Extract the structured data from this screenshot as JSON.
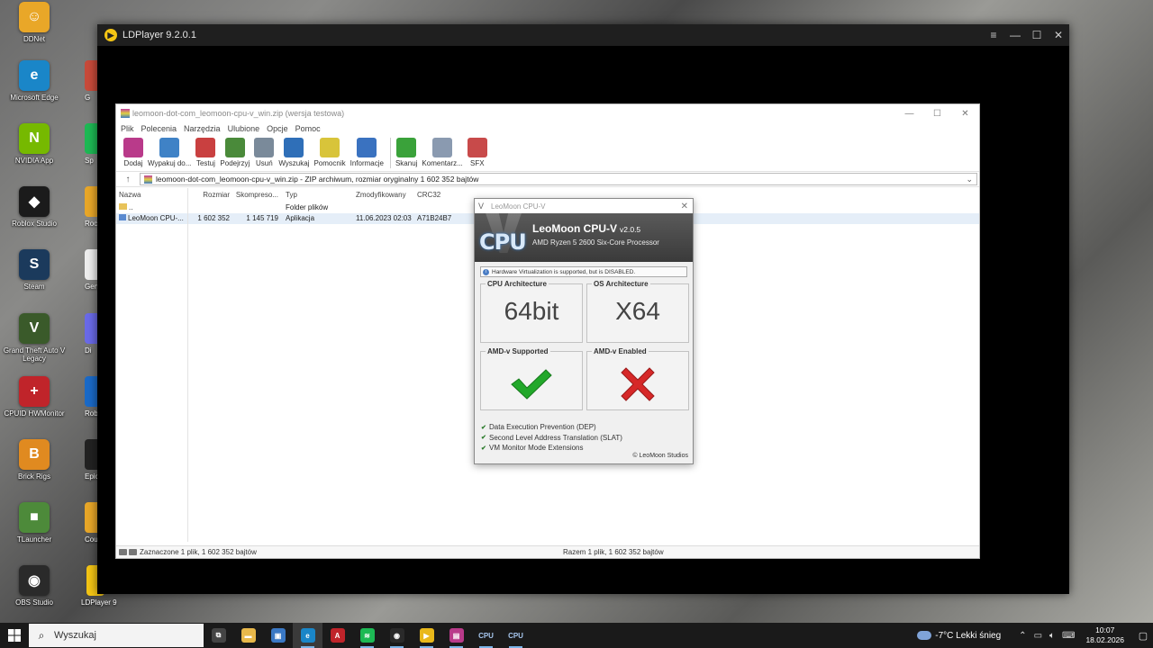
{
  "desktop": {
    "icons": [
      {
        "label": "DDNet",
        "color": "#e9a728",
        "glyph": "☺"
      },
      {
        "label": "Microsoft Edge",
        "color": "#1a86c8",
        "glyph": "e"
      },
      {
        "label": "NVIDIA App",
        "color": "#76b900",
        "glyph": "N"
      },
      {
        "label": "Roblox Studio",
        "color": "#1b1b1b",
        "glyph": "◆"
      },
      {
        "label": "Steam",
        "color": "#1b3a5c",
        "glyph": "S"
      },
      {
        "label": "Grand Theft Auto V Legacy",
        "color": "#3a5a2a",
        "glyph": "V"
      },
      {
        "label": "CPUID HWMonitor",
        "color": "#c0242a",
        "glyph": "+"
      },
      {
        "label": "Brick Rigs",
        "color": "#e08a20",
        "glyph": "B"
      },
      {
        "label": "TLauncher",
        "color": "#4d8a3a",
        "glyph": "■"
      },
      {
        "label": "OBS Studio",
        "color": "#2a2a2a",
        "glyph": "◉"
      }
    ],
    "partial_labels": [
      "G",
      "Sp",
      "Rocks Lau",
      "Gensh",
      "Di",
      "Robl",
      "Epic Lau",
      "Count",
      "LDPlayer 9"
    ]
  },
  "ldplayer": {
    "title": "LDPlayer 9.2.0.1",
    "controls": [
      "≡",
      "—",
      "☐",
      "✕"
    ]
  },
  "winrar": {
    "title": "leomoon-dot-com_leomoon-cpu-v_win.zip (wersja testowa)",
    "menu": [
      "Plik",
      "Polecenia",
      "Narzędzia",
      "Ulubione",
      "Opcje",
      "Pomoc"
    ],
    "toolbar": [
      {
        "label": "Dodaj",
        "color": "#b93a8a"
      },
      {
        "label": "Wypakuj do...",
        "color": "#3f82c6"
      },
      {
        "label": "Testuj",
        "color": "#c94040"
      },
      {
        "label": "Podejrzyj",
        "color": "#4a8a3a"
      },
      {
        "label": "Usuń",
        "color": "#7a8a9a"
      },
      {
        "label": "Wyszukaj",
        "color": "#2f6fb8"
      },
      {
        "label": "Pomocnik",
        "color": "#d8c43a"
      },
      {
        "label": "Informacje",
        "color": "#3a72c0"
      },
      {
        "label": "Skanuj",
        "color": "#3aa23a"
      },
      {
        "label": "Komentarz...",
        "color": "#8a9ab0"
      },
      {
        "label": "SFX",
        "color": "#c84a4a"
      }
    ],
    "address": "leomoon-dot-com_leomoon-cpu-v_win.zip - ZIP archiwum, rozmiar oryginalny 1 602 352 bajtów",
    "columns": {
      "name": "Nazwa",
      "size": "Rozmiar",
      "packed": "Skompreso...",
      "type": "Typ",
      "modified": "Zmodyfikowany",
      "crc": "CRC32"
    },
    "rows": [
      {
        "name": "..",
        "size": "",
        "packed": "",
        "type": "Folder plików",
        "modified": "",
        "crc": ""
      },
      {
        "name": "LeoMoon CPU-...",
        "size": "1 602 352",
        "packed": "1 145 719",
        "type": "Aplikacja",
        "modified": "11.06.2023 02:03",
        "crc": "A71B24B7"
      }
    ],
    "status_left": "Zaznaczone 1 plik, 1 602 352 bajtów",
    "status_right": "Razem 1 plik, 1 602 352 bajtów"
  },
  "cpuv": {
    "window_title": "LeoMoon CPU-V",
    "close": "✕",
    "logo": "CPU",
    "app_name": "LeoMoon CPU-V",
    "version": "v2.0.5",
    "processor": "AMD Ryzen 5 2600 Six-Core Processor",
    "hint": "Hardware Virtualization is supported, but is DISABLED.",
    "boxes": {
      "cpu_arch_title": "CPU Architecture",
      "cpu_arch_value": "64bit",
      "os_arch_title": "OS Architecture",
      "os_arch_value": "X64",
      "amdv_supported_title": "AMD-v Supported",
      "amdv_supported_icon": "green-check-icon",
      "amdv_enabled_title": "AMD-v Enabled",
      "amdv_enabled_icon": "red-x-icon"
    },
    "features": [
      "Data Execution Prevention (DEP)",
      "Second Level Address Translation (SLAT)",
      "VM Monitor Mode Extensions"
    ],
    "copyright": "© LeoMoon Studios",
    "colors": {
      "check": "#22a82a",
      "cross": "#d62828"
    }
  },
  "taskbar": {
    "search_placeholder": "Wyszukaj",
    "apps": [
      {
        "name": "task-view",
        "color": "#444",
        "glyph": "⧉"
      },
      {
        "name": "file-explorer",
        "color": "#e8b84a",
        "glyph": "▬"
      },
      {
        "name": "store",
        "color": "#3a78c4",
        "glyph": "▣"
      },
      {
        "name": "edge",
        "color": "#1a86c8",
        "glyph": "e"
      },
      {
        "name": "affinity",
        "color": "#c0242a",
        "glyph": "A"
      },
      {
        "name": "spotify",
        "color": "#1db954",
        "glyph": "≋"
      },
      {
        "name": "obs",
        "color": "#2a2a2a",
        "glyph": "◉"
      },
      {
        "name": "ldplayer",
        "color": "#e9b81a",
        "glyph": "▶"
      },
      {
        "name": "winrar",
        "color": "#b93a8a",
        "glyph": "▤"
      },
      {
        "name": "cpuv-1",
        "color": "#2a4a7a",
        "glyph": "CPU"
      },
      {
        "name": "cpuv-2",
        "color": "#2a4a7a",
        "glyph": "CPU"
      }
    ],
    "weather": "-7°C  Lekki śnieg",
    "time": "10:07",
    "date": "18.02.2026"
  }
}
